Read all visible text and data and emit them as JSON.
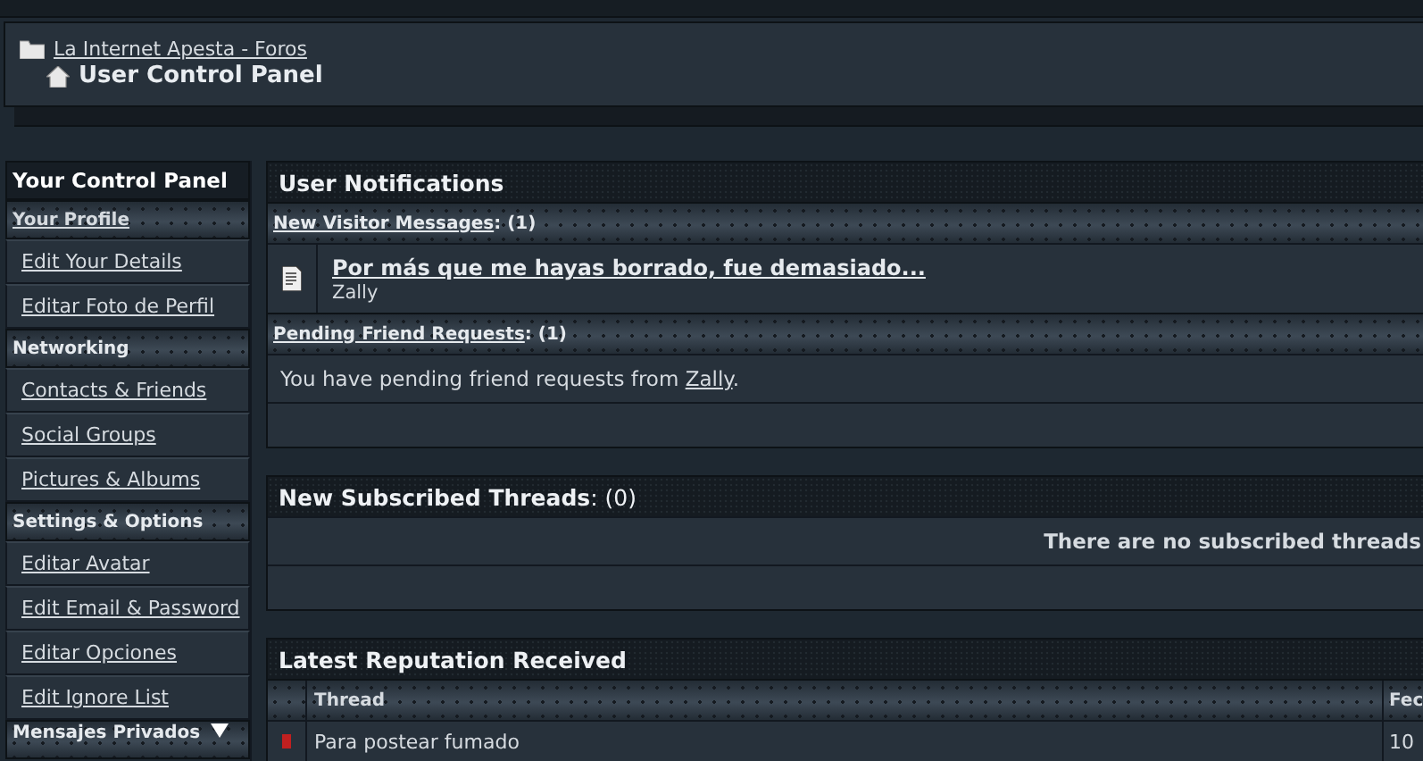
{
  "breadcrumb": {
    "parent": "La Internet Apesta - Foros",
    "current": "User Control Panel"
  },
  "sidebar": {
    "title": "Your Control Panel",
    "sections": [
      {
        "heading": "Your Profile",
        "kind": "link",
        "items": [
          "Edit Your Details",
          "Editar Foto de Perfil"
        ]
      },
      {
        "heading": "Networking",
        "kind": "plain",
        "items": [
          "Contacts & Friends",
          "Social Groups",
          "Pictures & Albums"
        ]
      },
      {
        "heading": "Settings & Options",
        "kind": "plain",
        "items": [
          "Editar Avatar",
          "Edit Email & Password",
          "Editar Opciones",
          "Edit Ignore List"
        ]
      },
      {
        "heading": "Mensajes Privados",
        "kind": "collapsible"
      }
    ]
  },
  "notifications": {
    "title": "User Notifications",
    "visitor_messages": {
      "label": "New Visitor Messages",
      "count": ": (1)",
      "message_title": "Por más que me hayas borrado, fue demasiado...",
      "author": "Zally"
    },
    "friend_requests": {
      "label": "Pending Friend Requests",
      "count": ": (1)",
      "text": "You have pending friend requests from ",
      "link": "Zally",
      "end": "."
    }
  },
  "subscribed": {
    "title": "New Subscribed Threads",
    "count": ": (0)",
    "message": "There are no subscribed threads"
  },
  "reputation": {
    "title": "Latest Reputation Received",
    "columns": [
      "Thread",
      "Fec"
    ],
    "rows": [
      {
        "thread": "Para postear fumado",
        "date": "10"
      }
    ]
  }
}
